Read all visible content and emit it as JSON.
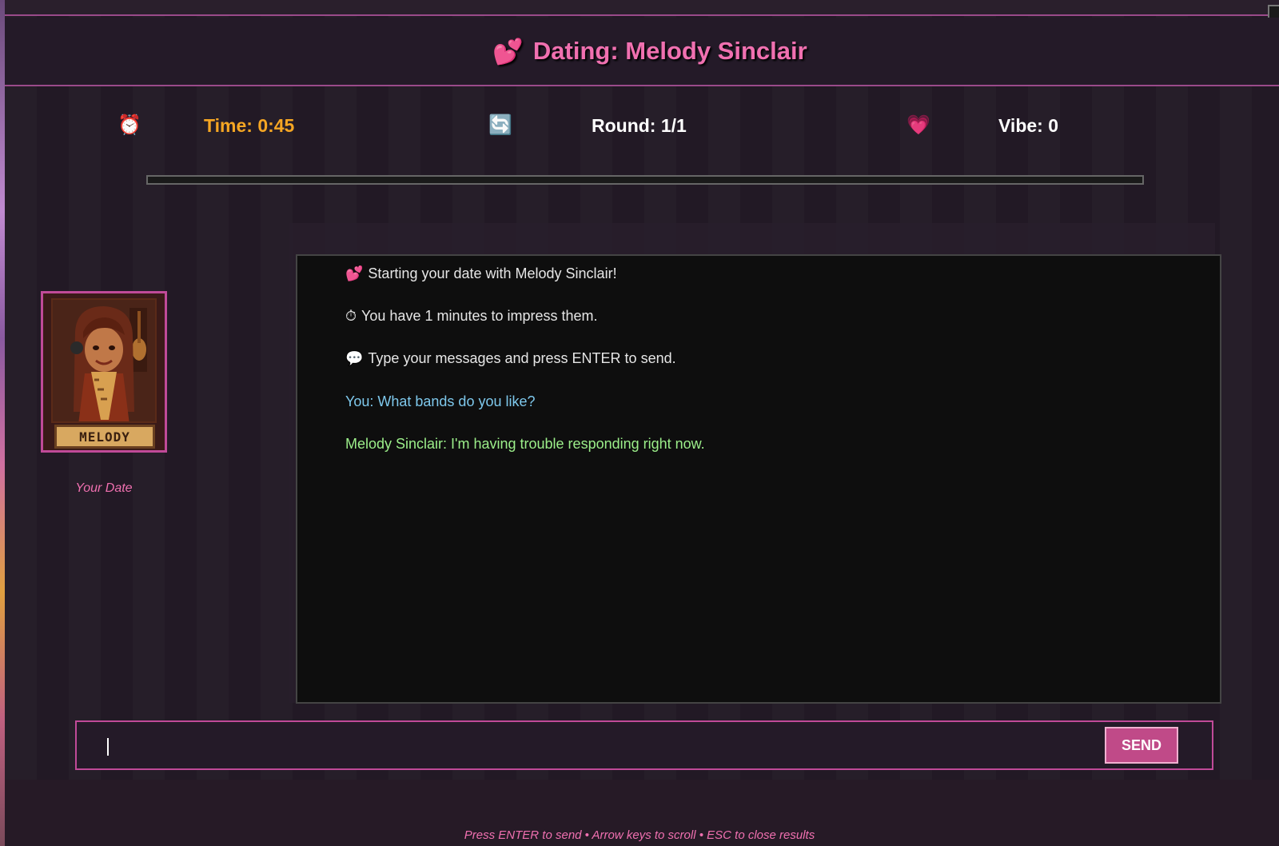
{
  "header": {
    "icon": "two-hearts-icon",
    "icon_glyph": "💕",
    "title": "Dating: Melody Sinclair"
  },
  "stats": {
    "time": {
      "icon": "alarm-clock-icon",
      "icon_glyph": "⏰",
      "label": "Time: 0:45",
      "color": "#f5a623"
    },
    "round": {
      "icon": "refresh-icon",
      "icon_glyph": "🔄",
      "label": "Round: 1/1"
    },
    "vibe": {
      "icon": "heart-icon",
      "icon_glyph": "💗",
      "label": "Vibe: 0"
    }
  },
  "progress": {
    "fraction": 0.0
  },
  "chat": {
    "messages": [
      {
        "type": "system",
        "icon": "two-hearts-icon",
        "icon_glyph": "💕",
        "text": "Starting your date with Melody Sinclair!"
      },
      {
        "type": "system",
        "icon": "stopwatch-icon",
        "icon_glyph": "⏱",
        "text": "You have 1 minutes to impress them."
      },
      {
        "type": "system",
        "icon": "speech-bubble-icon",
        "icon_glyph": "💬",
        "text": "Type your messages and press ENTER to send."
      },
      {
        "type": "you",
        "text": "You: What bands do you like?"
      },
      {
        "type": "date",
        "text": "Melody Sinclair: I'm having trouble responding right now."
      }
    ]
  },
  "portrait": {
    "nameplate": "MELODY",
    "caption": "Your Date"
  },
  "input": {
    "value": "",
    "send_label": "SEND"
  },
  "footer": {
    "hint": "Press ENTER to send • Arrow keys to scroll • ESC to close results"
  },
  "colors": {
    "accent": "#f070b0",
    "border": "#c04a98",
    "you_text": "#7ec8ec",
    "date_text": "#9cef8a"
  }
}
